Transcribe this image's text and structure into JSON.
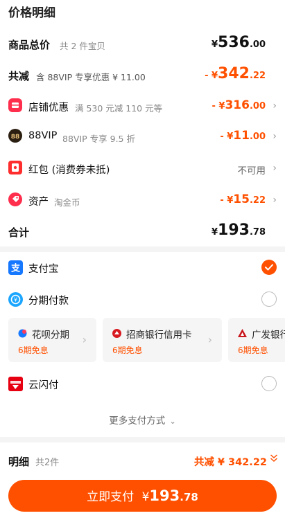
{
  "title": "价格明细",
  "total_price": {
    "label": "商品总价",
    "sub": "共 2 件宝贝",
    "currency": "¥",
    "int": "536",
    "dec": ".00"
  },
  "total_discount": {
    "label": "共减",
    "sub": "含 88VIP 专享优惠 ¥ 11.00",
    "prefix": "- ¥",
    "int": "342",
    "dec": ".22"
  },
  "discounts": [
    {
      "label": "店铺优惠",
      "sub": "满 530 元减 110 元等",
      "prefix": "- ¥",
      "int": "316",
      "dec": ".00",
      "icon": "store-icon"
    },
    {
      "label": "88VIP",
      "sub": "88VIP 专享 9.5 折",
      "prefix": "- ¥",
      "int": "11",
      "dec": ".00",
      "icon": "vip88-icon"
    },
    {
      "label": "红包 (消费券未抵)",
      "status": "不可用",
      "icon": "red-packet-icon"
    },
    {
      "label": "资产",
      "sub": "淘金币",
      "prefix": "- ¥",
      "int": "15",
      "dec": ".22",
      "icon": "coin-tag-icon"
    }
  ],
  "subtotal": {
    "label": "合计",
    "currency": "¥",
    "int": "193",
    "dec": ".78"
  },
  "payment": {
    "alipay": "支付宝",
    "installment": "分期付款",
    "chips": [
      {
        "name": "花呗分期",
        "free": "6期免息",
        "icon": "huabei-icon"
      },
      {
        "name": "招商银行信用卡",
        "free": "6期免息",
        "icon": "cmb-icon"
      },
      {
        "name": "广发银行",
        "free": "6期免息",
        "icon": "cgb-icon"
      }
    ],
    "unionpay": "云闪付",
    "more": "更多支付方式"
  },
  "bottom": {
    "detail_label": "明细",
    "count": "共2件",
    "total_discount": "共减 ¥ 342.22",
    "pay_label": "立即支付",
    "currency": "¥",
    "int": "193",
    "dec": ".78"
  },
  "colors": {
    "accent": "#ff5000",
    "alipay": "#1677ff"
  }
}
